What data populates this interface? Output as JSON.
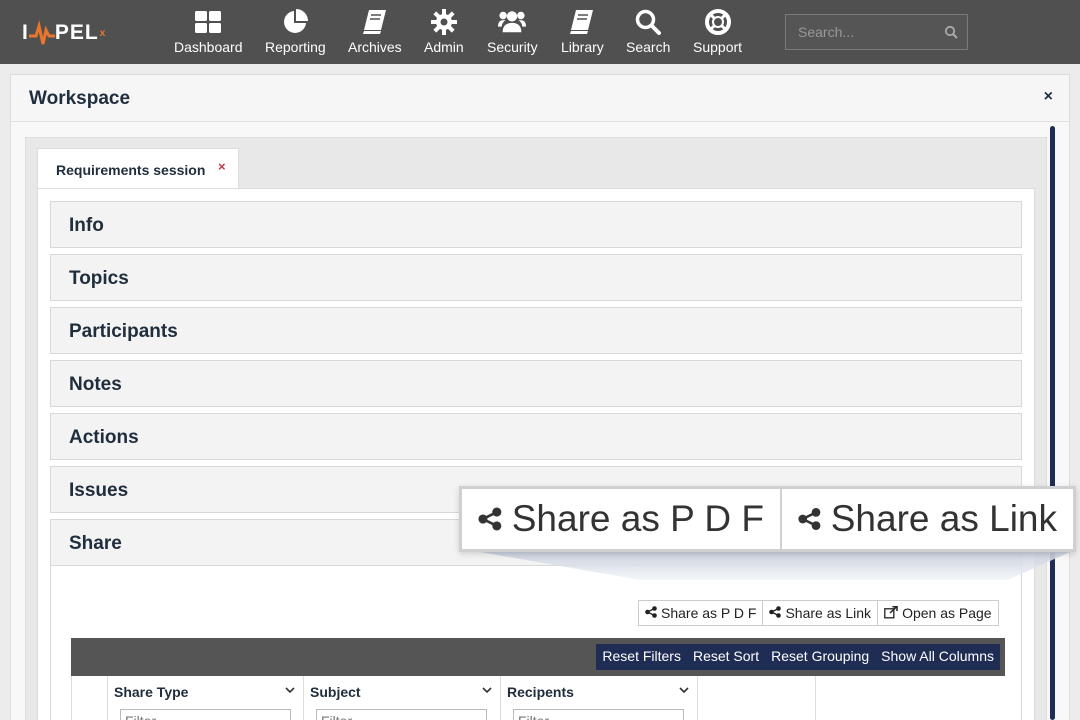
{
  "brand": {
    "logo_left": "I",
    "logo_right": "PEL",
    "logo_sup": "x",
    "accent": "#e8762c"
  },
  "nav": {
    "items": [
      {
        "label": "Dashboard",
        "icon": "dashboard-icon"
      },
      {
        "label": "Reporting",
        "icon": "pie-chart-icon"
      },
      {
        "label": "Archives",
        "icon": "book-icon"
      },
      {
        "label": "Admin",
        "icon": "gear-icon"
      },
      {
        "label": "Security",
        "icon": "users-icon"
      },
      {
        "label": "Library",
        "icon": "book-icon"
      },
      {
        "label": "Search",
        "icon": "search-icon"
      },
      {
        "label": "Support",
        "icon": "lifebuoy-icon"
      }
    ],
    "search_placeholder": "Search..."
  },
  "workspace": {
    "title": "Workspace",
    "close": "×",
    "tab": {
      "label": "Requirements session",
      "close": "×"
    },
    "sections": [
      "Info",
      "Topics",
      "Participants",
      "Notes",
      "Actions",
      "Issues",
      "Share"
    ]
  },
  "share": {
    "buttons": {
      "pdf": "Share as P D F",
      "link": "Share as Link",
      "page": "Open as Page"
    },
    "grid_toolbar": {
      "reset_filters": "Reset Filters",
      "reset_sort": "Reset Sort",
      "reset_grouping": "Reset Grouping",
      "show_all_columns": "Show All Columns"
    },
    "columns": [
      {
        "header": "Share Type",
        "filter_placeholder": "Filter..."
      },
      {
        "header": "Subject",
        "filter_placeholder": "Filter..."
      },
      {
        "header": "Recipents",
        "filter_placeholder": "Filter..."
      }
    ]
  },
  "callout": {
    "pdf": "Share as P D F",
    "link": "Share as Link"
  },
  "colors": {
    "topbar": "#505050",
    "navy": "#1f2d54",
    "title": "#1f2d3d",
    "close_red": "#c0394b"
  }
}
